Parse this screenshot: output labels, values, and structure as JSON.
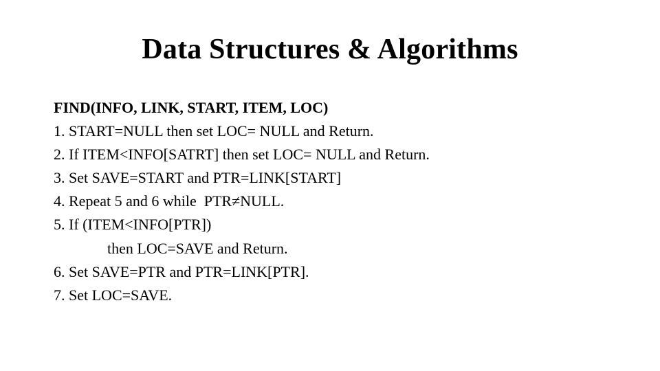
{
  "title": "Data Structures & Algorithms",
  "heading": "FIND(INFO, LINK, START, ITEM, LOC)",
  "steps": {
    "s1": "1. START=NULL then set LOC= NULL and Return.",
    "s2": "2. If ITEM<INFO[SATRT] then set LOC= NULL and Return.",
    "s3": "3. Set SAVE=START and PTR=LINK[START]",
    "s4": "4. Repeat 5 and 6 while  PTR≠NULL.",
    "s5": "5. If (ITEM<INFO[PTR])",
    "s5b": "then LOC=SAVE and Return.",
    "s6": "6. Set SAVE=PTR and PTR=LINK[PTR].",
    "s7": "7. Set LOC=SAVE."
  }
}
